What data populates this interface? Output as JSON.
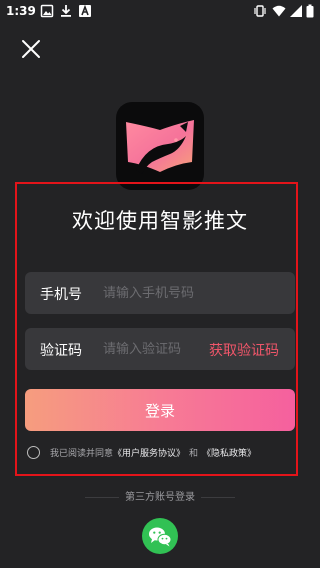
{
  "status_bar": {
    "time": "1:39",
    "left_icons": [
      "image-icon",
      "download-icon",
      "a-box-icon"
    ],
    "right_icons": [
      "vibrate-icon",
      "wifi-icon",
      "signal-icon",
      "battery-icon"
    ]
  },
  "header": {
    "close_icon": "close-icon"
  },
  "app": {
    "logo_icon": "app-logo-icon",
    "welcome_title": "欢迎使用智影推文"
  },
  "form": {
    "phone": {
      "label": "手机号",
      "value": "",
      "placeholder": "请输入手机号码"
    },
    "code": {
      "label": "验证码",
      "value": "",
      "placeholder": "请输入验证码",
      "get_code_label": "获取验证码"
    },
    "login_label": "登录",
    "agreement": {
      "checked": false,
      "prefix": "我已阅读并同意",
      "user_agreement": "《用户服务协议》",
      "and": "和",
      "privacy_policy": "《隐私政策》"
    }
  },
  "third_party": {
    "title": "第三方账号登录",
    "wechat_icon": "wechat-icon"
  },
  "colors": {
    "background": "#232325",
    "field_background": "#38383b",
    "accent_link": "#f0566a",
    "button_gradient_start": "#f69d7e",
    "button_gradient_end": "#f5609e",
    "highlight_frame": "#e3141a",
    "wechat_green": "#31c154"
  }
}
